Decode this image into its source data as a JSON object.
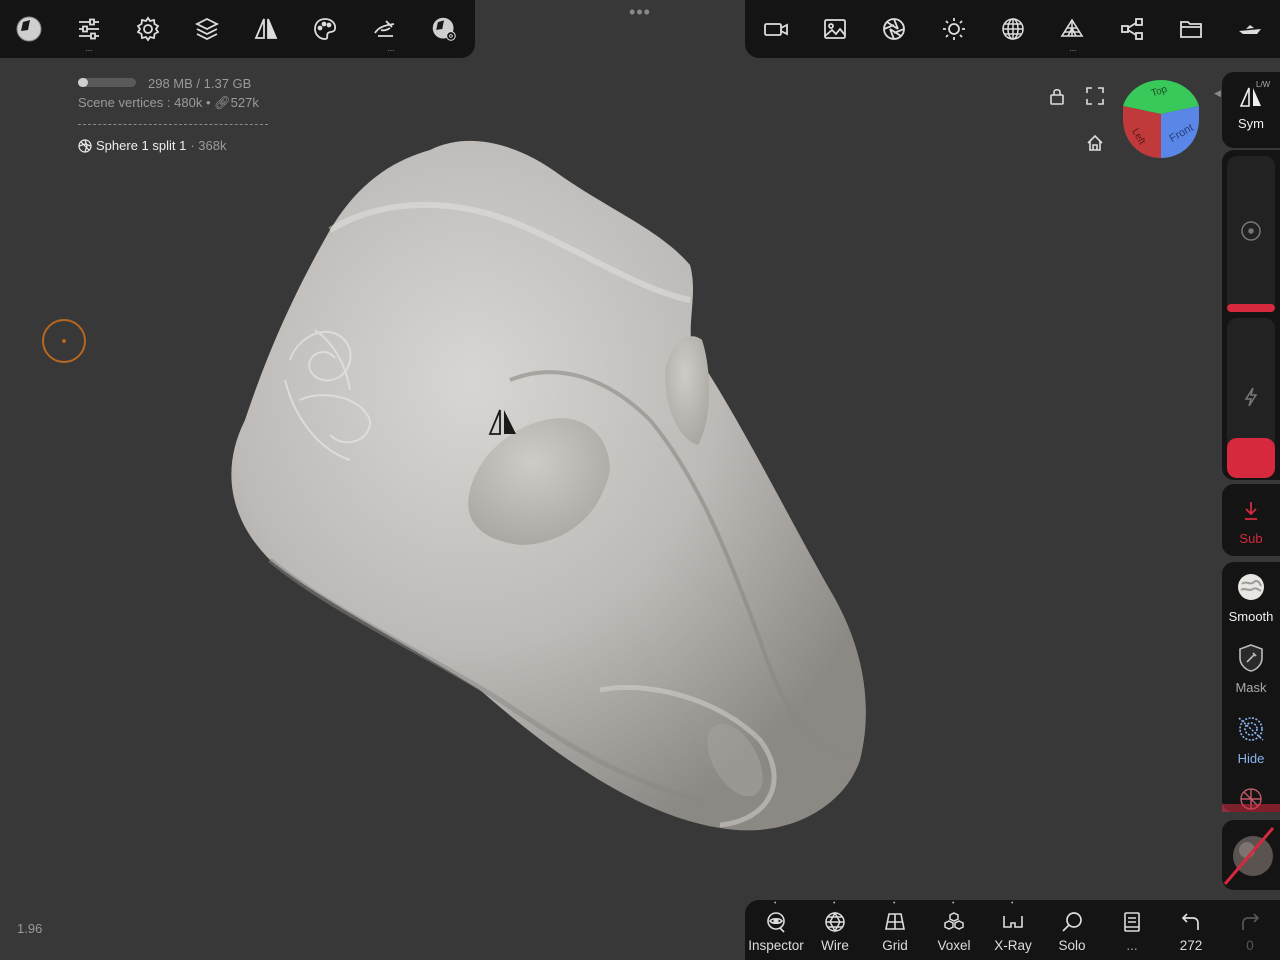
{
  "top_toolbar": {
    "left_icons": [
      "app-logo-icon",
      "sliders-icon",
      "gear-icon",
      "layers-icon",
      "symmetry-icon",
      "palette-icon",
      "hand-gesture-icon",
      "material-settings-icon"
    ],
    "right_icons": [
      "camera-icon",
      "image-icon",
      "aperture-icon",
      "sun-icon",
      "sphere-grid-icon",
      "pyramid-icon",
      "share-icon",
      "folder-icon",
      "boat-icon"
    ],
    "more_indicator": "•••"
  },
  "scene_info": {
    "memory": "298 MB / 1.37 GB",
    "memory_fraction": 0.17,
    "vertices_label": "Scene vertices :",
    "vertices_value": "480k",
    "separator": "•",
    "faces_value": "527k",
    "object_name": "Sphere 1 split 1",
    "object_vertices": "· 368k"
  },
  "viewport": {
    "gizmo_faces": [
      "Top",
      "Left",
      "Front"
    ],
    "gizmo_colors": {
      "top": "#39c95a",
      "left": "#c0393b",
      "front": "#5a86e8"
    }
  },
  "right_rail": {
    "sym_label": "Sym",
    "sym_badge": "L/W",
    "sub_label": "Sub",
    "smooth_label": "Smooth",
    "mask_label": "Mask",
    "hide_label": "Hide",
    "accent_color": "#d6293e",
    "hide_color": "#8ab4f0",
    "radius_level": 0.03,
    "intensity_level": 0.25
  },
  "bottom_bar": {
    "inspector": "Inspector",
    "wire": "Wire",
    "grid": "Grid",
    "voxel": "Voxel",
    "xray": "X-Ray",
    "solo": "Solo",
    "more": "...",
    "undo_count": "272",
    "redo_count": "0"
  },
  "fps_value": "1.96"
}
